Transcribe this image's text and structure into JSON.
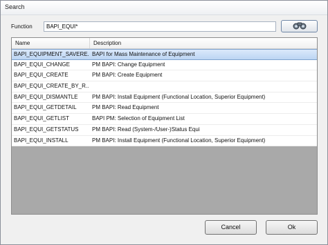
{
  "window": {
    "title": "Search"
  },
  "search": {
    "label": "Function",
    "value": "BAPI_EQUI*",
    "button_icon": "binoculars-icon"
  },
  "table": {
    "columns": {
      "name": "Name",
      "description": "Description"
    },
    "rows": [
      {
        "name": "BAPI_EQUIPMENT_SAVEREPLICA",
        "display_name": "BAPI_EQUIPMENT_SAVERE...",
        "description": "BAPI for Mass Maintenance of Equipment",
        "selected": true
      },
      {
        "name": "BAPI_EQUI_CHANGE",
        "display_name": "BAPI_EQUI_CHANGE",
        "description": "PM BAPI: Change Equipment"
      },
      {
        "name": "BAPI_EQUI_CREATE",
        "display_name": "BAPI_EQUI_CREATE",
        "description": "PM BAPI: Create Equipment"
      },
      {
        "name": "BAPI_EQUI_CREATE_BY_R",
        "display_name": "BAPI_EQUI_CREATE_BY_R...",
        "description": ""
      },
      {
        "name": "BAPI_EQUI_DISMANTLE",
        "display_name": "BAPI_EQUI_DISMANTLE",
        "description": "PM BAPI: Install Equipment (Functional Location, Superior Equipment)"
      },
      {
        "name": "BAPI_EQUI_GETDETAIL",
        "display_name": "BAPI_EQUI_GETDETAIL",
        "description": "PM BAPI: Read Equipment"
      },
      {
        "name": "BAPI_EQUI_GETLIST",
        "display_name": "BAPI_EQUI_GETLIST",
        "description": "BAPI PM: Selection of Equipment List"
      },
      {
        "name": "BAPI_EQUI_GETSTATUS",
        "display_name": "BAPI_EQUI_GETSTATUS",
        "description": "PM BAPI: Read (System-/User-)Status Equi"
      },
      {
        "name": "BAPI_EQUI_INSTALL",
        "display_name": "BAPI_EQUI_INSTALL",
        "description": "PM BAPI: Install Equipment (Functional Location, Superior Equipment)"
      }
    ]
  },
  "buttons": {
    "cancel": "Cancel",
    "ok": "Ok"
  },
  "colors": {
    "selection": "#c9ddf6",
    "empty_grid": "#a9a9a9",
    "window_bg": "#f0f0f0"
  }
}
